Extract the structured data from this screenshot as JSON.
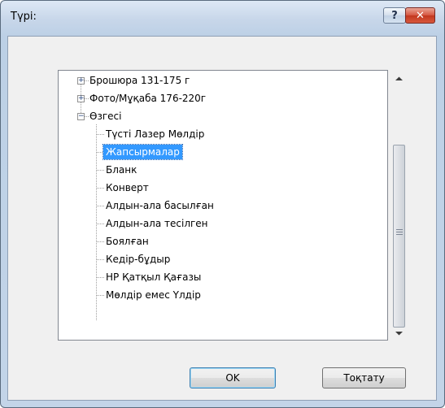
{
  "window": {
    "title": "Түрі:",
    "help_label": "?",
    "close_label": "✕"
  },
  "tree": {
    "items": [
      {
        "label": "Брошюра 131-175 г",
        "expander": "+"
      },
      {
        "label": "Фото/Мұқаба 176-220г",
        "expander": "+"
      },
      {
        "label": "Өзгесі",
        "expander": "−"
      },
      {
        "label": "Түсті Лазер Мөлдір"
      },
      {
        "label": "Жапсырмалар",
        "selected": true
      },
      {
        "label": "Бланк"
      },
      {
        "label": "Конверт"
      },
      {
        "label": "Алдын-ала басылған"
      },
      {
        "label": "Алдын-ала тесілген"
      },
      {
        "label": "Боялған"
      },
      {
        "label": "Кедір-бұдыр"
      },
      {
        "label": "HP Қатқыл Қағазы"
      },
      {
        "label": "Мөлдір емес Үлдір"
      }
    ]
  },
  "buttons": {
    "ok": "OK",
    "cancel": "Тоқтату"
  },
  "colors": {
    "selection": "#3399ff",
    "close_button": "#c7442f"
  }
}
